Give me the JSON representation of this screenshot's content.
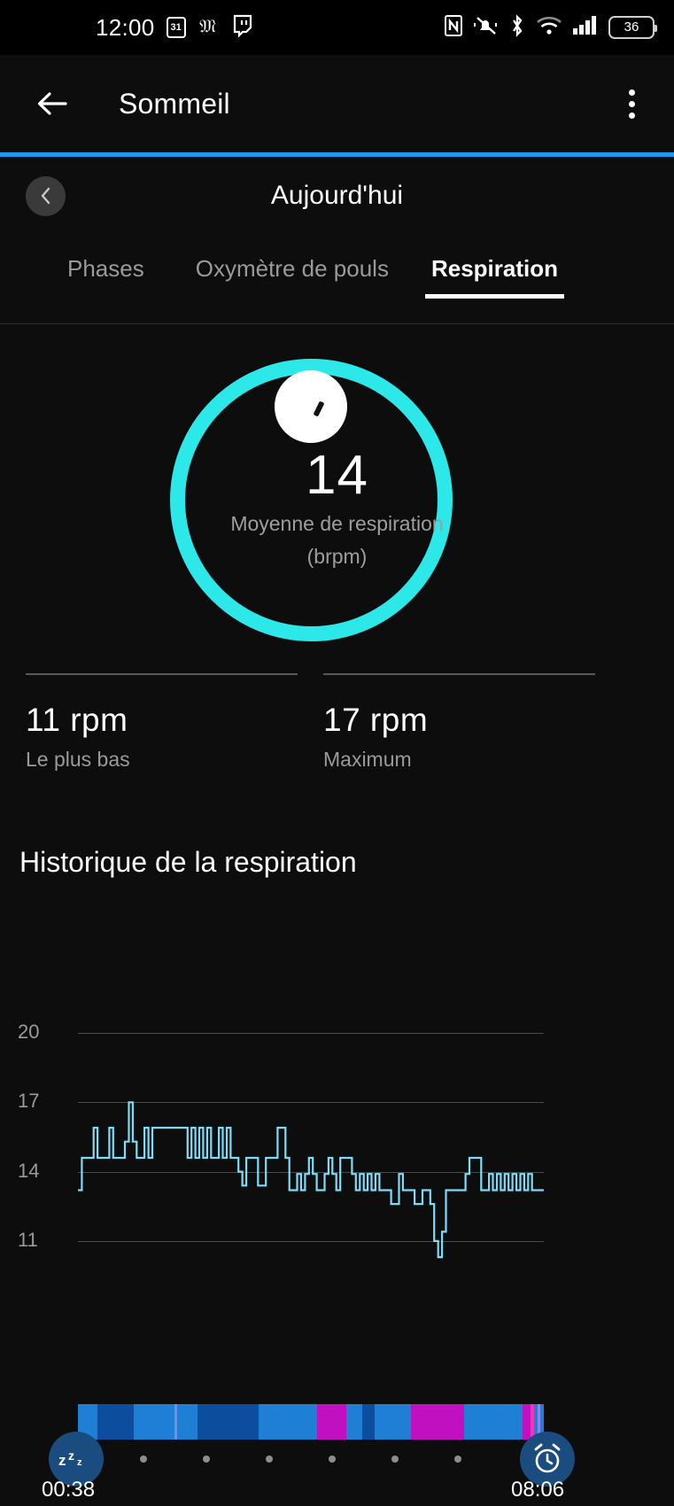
{
  "statusbar": {
    "clock": "12:00",
    "calendar_day": "31",
    "battery_level": "36",
    "icons": [
      "calendar-icon",
      "mastodon-icon",
      "twitch-icon",
      "nfc-icon",
      "mute-bell-icon",
      "bluetooth-icon",
      "wifi-icon",
      "cellular-signal-icon",
      "battery-icon"
    ]
  },
  "appbar": {
    "title": "Sommeil",
    "back_icon": "back-arrow-icon",
    "overflow_icon": "kebab-menu-icon"
  },
  "daterow": {
    "prev_icon": "chevron-left-icon",
    "label": "Aujourd'hui"
  },
  "tabs": [
    {
      "label": "Phases",
      "active": false
    },
    {
      "label": "Oxymètre de pouls",
      "active": false
    },
    {
      "label": "Respiration",
      "active": true
    }
  ],
  "gauge": {
    "value": "14",
    "label_line1": "Moyenne de respiration",
    "label_line2": "(brpm)",
    "ring_color": "#2ce8e8",
    "knob_color": "#ffffff"
  },
  "stats": [
    {
      "value": "11 rpm",
      "caption": "Le plus bas"
    },
    {
      "value": "17 rpm",
      "caption": "Maximum"
    }
  ],
  "history": {
    "title": "Historique de la respiration"
  },
  "timeline": {
    "start_time": "00:38",
    "end_time": "08:06",
    "start_icon": "sleep-zzz-icon",
    "end_icon": "alarm-clock-icon",
    "dot_count": 6,
    "segments": [
      {
        "color": "#1f7fd4",
        "width": 4.2
      },
      {
        "color": "#0d4d9e",
        "width": 8.0
      },
      {
        "color": "#1f7fd4",
        "width": 8.8
      },
      {
        "color": "#7a8ce0",
        "width": 0.5
      },
      {
        "color": "#1f7fd4",
        "width": 4.5
      },
      {
        "color": "#0d4d9e",
        "width": 13.3
      },
      {
        "color": "#1f7fd4",
        "width": 12.6
      },
      {
        "color": "#c010c0",
        "width": 6.3
      },
      {
        "color": "#1f7fd4",
        "width": 3.6
      },
      {
        "color": "#0d4d9e",
        "width": 2.7
      },
      {
        "color": "#1f7fd4",
        "width": 7.8
      },
      {
        "color": "#c010c0",
        "width": 11.5
      },
      {
        "color": "#1f7fd4",
        "width": 12.8
      },
      {
        "color": "#c010c0",
        "width": 1.7
      },
      {
        "color": "#ee3ab0",
        "width": 0.7
      },
      {
        "color": "#1f7fd4",
        "width": 0.9
      },
      {
        "color": "#c86ae8",
        "width": 0.5
      },
      {
        "color": "#1f7fd4",
        "width": 0.8
      }
    ]
  },
  "chart_data": {
    "type": "line",
    "title": "Historique de la respiration",
    "xlabel": "",
    "ylabel": "brpm",
    "ylim": [
      9.5,
      21
    ],
    "yticks": [
      20,
      17,
      14,
      11
    ],
    "grid": true,
    "line_color": "#7ddcf7",
    "x_start_label": "00:38",
    "x_end_label": "08:06",
    "series": [
      {
        "name": "Respiration",
        "values": [
          13.2,
          14.6,
          14.6,
          14.6,
          15.9,
          14.6,
          14.6,
          14.6,
          15.9,
          14.6,
          14.6,
          14.6,
          15.3,
          17.0,
          15.3,
          14.6,
          14.6,
          15.9,
          14.6,
          15.9,
          15.9,
          15.9,
          15.9,
          15.9,
          15.9,
          15.9,
          15.9,
          15.9,
          14.6,
          15.9,
          14.6,
          15.9,
          14.6,
          15.9,
          14.6,
          14.6,
          15.9,
          14.6,
          15.9,
          14.6,
          14.6,
          14.0,
          13.4,
          14.6,
          14.6,
          14.6,
          13.4,
          13.4,
          14.6,
          14.6,
          14.6,
          15.9,
          15.9,
          14.6,
          13.2,
          13.2,
          13.9,
          13.2,
          13.9,
          14.6,
          13.9,
          13.2,
          13.2,
          13.9,
          14.6,
          13.9,
          13.2,
          14.6,
          14.6,
          14.6,
          13.9,
          13.2,
          13.9,
          13.2,
          13.9,
          13.2,
          13.9,
          13.2,
          13.2,
          13.2,
          12.6,
          12.6,
          13.9,
          13.2,
          13.2,
          13.2,
          12.6,
          12.6,
          13.2,
          13.2,
          12.6,
          11.0,
          10.3,
          11.4,
          13.2,
          13.2,
          13.2,
          13.2,
          13.2,
          13.9,
          14.6,
          14.6,
          14.6,
          13.2,
          13.2,
          13.9,
          13.2,
          13.9,
          13.2,
          13.9,
          13.2,
          13.9,
          13.2,
          13.9,
          13.2,
          13.9,
          13.2,
          13.2,
          13.2,
          13.2
        ]
      }
    ]
  }
}
